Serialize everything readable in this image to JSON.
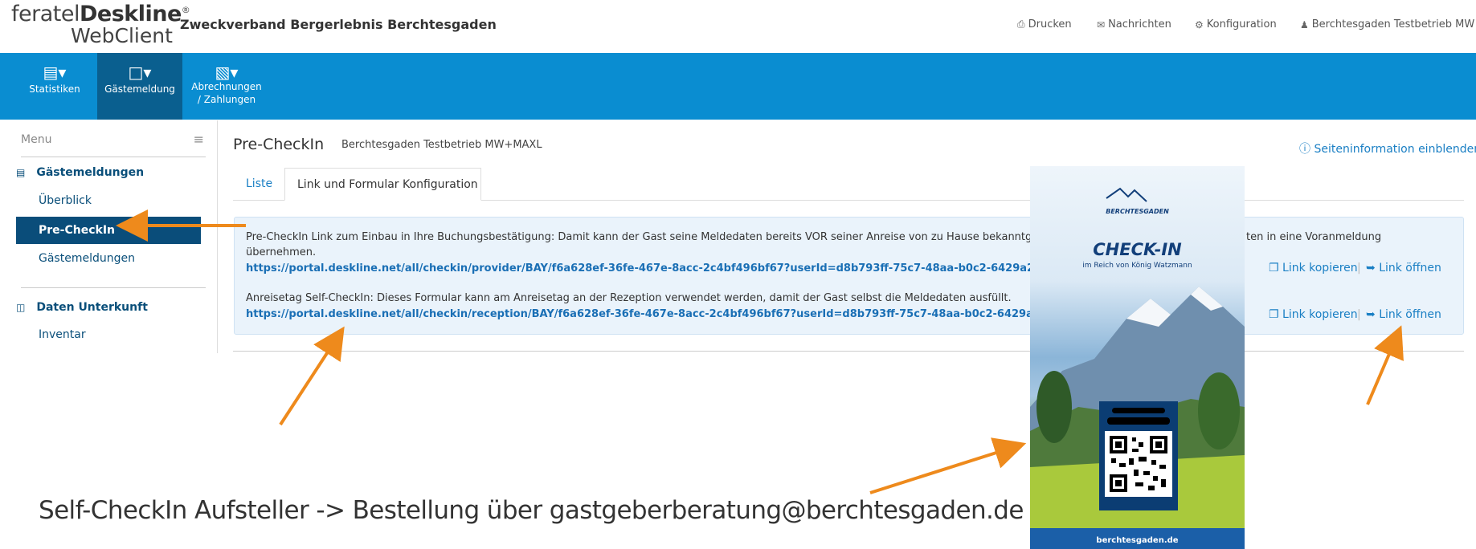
{
  "logo": {
    "brand_prefix": "feratel",
    "brand_bold": "Deskline",
    "reg": "®",
    "sub": "WebClient"
  },
  "header": {
    "org_title": "Zweckverband Bergerlebnis Berchtesgaden",
    "links": {
      "print": "Drucken",
      "messages": "Nachrichten",
      "config": "Konfiguration",
      "user": "Berchtesgaden Testbetrieb MW"
    }
  },
  "toolbar": {
    "stats": "Statistiken",
    "guest": "Gästemeldung",
    "billing_1": "Abrechnungen",
    "billing_2": "/ Zahlungen"
  },
  "sidebar": {
    "menu_label": "Menu",
    "section1": "Gästemeldungen",
    "item_overview": "Überblick",
    "item_precheckin": "Pre-CheckIn",
    "item_guest": "Gästemeldungen",
    "section2": "Daten Unterkunft",
    "item_inventory": "Inventar"
  },
  "main": {
    "title": "Pre-CheckIn",
    "subtitle": "Berchtesgaden Testbetrieb MW+MAXL",
    "page_info": "Seiteninformation einblenden",
    "tab_list": "Liste",
    "tab_link": "Link und Formular Konfiguration"
  },
  "panel": {
    "text1a": "Pre-CheckIn Link zum Einbau in Ihre Buchungsbestätigung: Damit kann der Gast seine Meldedaten bereits VOR seiner Anreise von zu Hause bekanntgeben.",
    "text1b": "ten in eine Voranmeldung",
    "text1c": "übernehmen.",
    "link1": "https://portal.deskline.net/all/checkin/provider/BAY/f6a628ef-36fe-467e-8acc-2c4bf496bf67?userId=d8b793ff-75c7-48aa-b0c2-6429a290b1e0",
    "text2": "Anreisetag Self-CheckIn: Dieses Formular kann am Anreisetag an der Rezeption verwendet werden, damit der Gast selbst die Meldedaten ausfüllt.",
    "link2": "https://portal.deskline.net/all/checkin/reception/BAY/f6a628ef-36fe-467e-8acc-2c4bf496bf67?userId=d8b793ff-75c7-48aa-b0c2-6429a290b1e0",
    "copy": "Link kopieren",
    "sep": "|",
    "open": "Link öffnen"
  },
  "flyer": {
    "brand": "BERCHTESGADEN",
    "title": "CHECK-IN",
    "subtitle": "im Reich von König Watzmann",
    "footer": "berchtesgaden.de"
  },
  "note": "Self-CheckIn Aufsteller -> Bestellung über gastgeberberatung@berchtesgaden.de",
  "colors": {
    "toolbar": "#0a8dd1",
    "active": "#0a4d7a",
    "link": "#1a7fc4",
    "arrow": "#ee8a1c"
  }
}
